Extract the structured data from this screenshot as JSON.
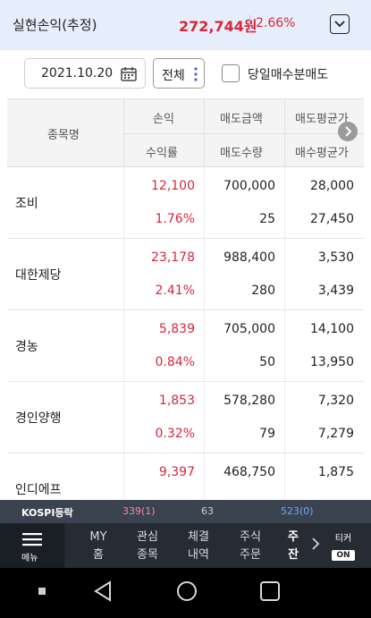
{
  "summary": {
    "label": "실현손익(추정)",
    "amount": "272,744원",
    "percent": "2.66%",
    "toggle_icon": "chevron-down-icon"
  },
  "filter": {
    "date": "2021.10.20",
    "calendar_icon": "calendar-icon",
    "scope": "전체",
    "same_day_label": "당일매수분매도",
    "same_day_checked": false
  },
  "table": {
    "headers": {
      "name": "종목명",
      "profit": "손익",
      "sell_amount": "매도금액",
      "sell_avg": "매도평균가",
      "rate": "수익률",
      "sell_qty": "매도수량",
      "buy_avg": "매수평균가"
    },
    "rows": [
      {
        "name": "조비",
        "profit": "12,100",
        "sell_amount": "700,000",
        "sell_avg": "28,000",
        "rate": "1.76%",
        "sell_qty": "25",
        "buy_avg": "27,450"
      },
      {
        "name": "대한제당",
        "profit": "23,178",
        "sell_amount": "988,400",
        "sell_avg": "3,530",
        "rate": "2.41%",
        "sell_qty": "280",
        "buy_avg": "3,439"
      },
      {
        "name": "경농",
        "profit": "5,839",
        "sell_amount": "705,000",
        "sell_avg": "14,100",
        "rate": "0.84%",
        "sell_qty": "50",
        "buy_avg": "13,950"
      },
      {
        "name": "경인양행",
        "profit": "1,853",
        "sell_amount": "578,280",
        "sell_avg": "7,320",
        "rate": "0.32%",
        "sell_qty": "79",
        "buy_avg": "7,279"
      },
      {
        "name": "인디에프",
        "profit": "9,397",
        "sell_amount": "468,750",
        "sell_avg": "1,875",
        "rate": "",
        "sell_qty": "",
        "buy_avg": ""
      }
    ]
  },
  "ticker": {
    "label": "KOSPI등락",
    "up": "339(1)",
    "flat": "63",
    "down": "523(0)"
  },
  "nav": {
    "menu_label": "메뉴",
    "items": [
      {
        "line1": "MY",
        "line2": "홈"
      },
      {
        "line1": "관심",
        "line2": "종목"
      },
      {
        "line1": "체결",
        "line2": "내역"
      },
      {
        "line1": "주식",
        "line2": "주문"
      },
      {
        "line1": "주",
        "line2": "잔"
      }
    ],
    "ticker_label": "티커",
    "ticker_state": "ON"
  },
  "colors": {
    "gain": "#d8263a",
    "summary_bg": "#e6eefb",
    "nav_bg": "#262b34"
  }
}
